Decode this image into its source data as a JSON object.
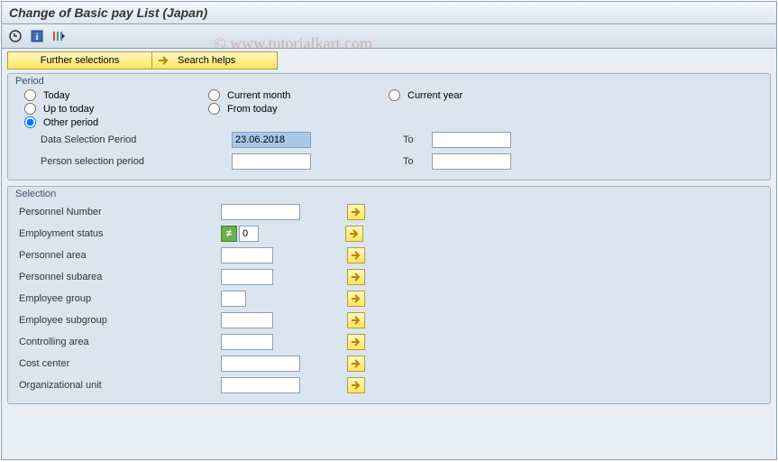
{
  "title": "Change of Basic pay List (Japan)",
  "watermark": "© www.tutorialkart.com",
  "toolbar": {
    "execute_icon": "execute",
    "info_icon": "info",
    "variant_icon": "variant"
  },
  "buttons": {
    "further_selections": "Further selections",
    "search_helps": "Search helps"
  },
  "period": {
    "title": "Period",
    "today": "Today",
    "current_month": "Current month",
    "current_year": "Current year",
    "up_to_today": "Up to today",
    "from_today": "From today",
    "other_period": "Other period",
    "selected": "other_period",
    "data_selection_label": "Data Selection Period",
    "data_selection_from": "23.06.2018",
    "data_selection_to": "",
    "person_selection_label": "Person selection period",
    "person_selection_from": "",
    "person_selection_to": "",
    "to_label": "To"
  },
  "selection": {
    "title": "Selection",
    "fields": {
      "personnel_number": {
        "label": "Personnel Number",
        "value": ""
      },
      "employment_status": {
        "label": "Employment status",
        "value": "0",
        "ne_flag": true
      },
      "personnel_area": {
        "label": "Personnel area",
        "value": ""
      },
      "personnel_subarea": {
        "label": "Personnel subarea",
        "value": ""
      },
      "employee_group": {
        "label": "Employee group",
        "value": ""
      },
      "employee_subgroup": {
        "label": "Employee subgroup",
        "value": ""
      },
      "controlling_area": {
        "label": "Controlling area",
        "value": ""
      },
      "cost_center": {
        "label": "Cost center",
        "value": ""
      },
      "organizational_unit": {
        "label": "Organizational unit",
        "value": ""
      }
    }
  }
}
